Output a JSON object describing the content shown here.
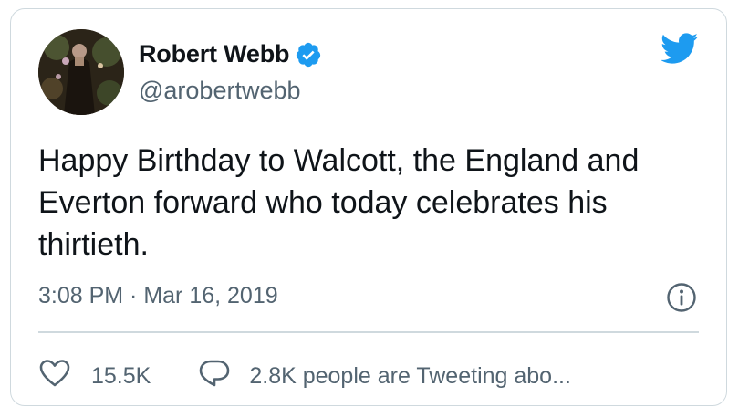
{
  "tweet": {
    "author_name": "Robert Webb",
    "handle": "@arobertwebb",
    "verified": true,
    "text": "Happy Birthday to Walcott, the England and Everton forward who today celebrates his thirtieth.",
    "timestamp": "3:08 PM · Mar 16, 2019",
    "like_count": "15.5K",
    "conversation_text": "2.8K people are Tweeting abo..."
  },
  "colors": {
    "brand": "#1d9bf0",
    "text_primary": "#0f1419",
    "text_secondary": "#536471",
    "border": "#cfd9de"
  },
  "icons": {
    "logo": "twitter-bird-icon",
    "verified": "verified-badge-icon",
    "info": "info-icon",
    "like": "heart-icon",
    "reply": "speech-bubble-icon"
  }
}
